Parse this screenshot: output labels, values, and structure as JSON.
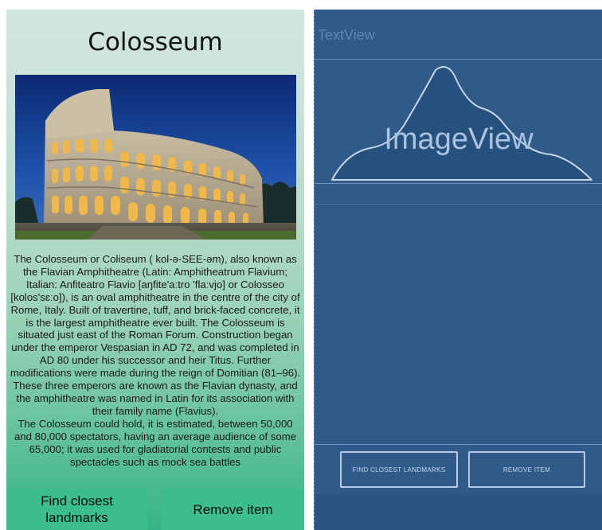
{
  "phone": {
    "title": "Colosseum",
    "description_paragraphs": [
      "The Colosseum or Coliseum ( kol-ə-SEE-əm), also known as the Flavian Amphitheatre (Latin: Amphitheatrum Flavium; Italian: Anfiteatro Flavio [aŋfite'aːtro 'flaːvjo] or Colosseo [kolos'sɛːo]), is an oval amphitheatre in the centre of the city of Rome, Italy. Built of travertine, tuff, and brick-faced concrete, it is the largest amphitheatre ever built. The Colosseum is situated just east of the Roman Forum. Construction began under the emperor Vespasian in AD 72, and was completed in AD 80 under his successor and heir Titus. Further modifications were made during the reign of Domitian (81–96). These three emperors are known as the Flavian dynasty, and the amphitheatre was named in Latin for its association with their family name (Flavius).",
      "The Colosseum could hold, it is estimated, between 50,000 and 80,000 spectators, having an average audience of some 65,000; it was used for gladiatorial contests and public spectacles such as mock sea battles"
    ],
    "buttons": {
      "find_label": "Find closest landmarks",
      "remove_label": "Remove item"
    }
  },
  "blueprint": {
    "textview_label": "TextView",
    "imageview_label": "ImageView",
    "find_label": "FIND CLOSEST LANDMARKS",
    "remove_label": "REMOVE ITEM"
  },
  "colors": {
    "button_green": "#3bbd8c",
    "blueprint_blue": "#2f5a8a"
  }
}
